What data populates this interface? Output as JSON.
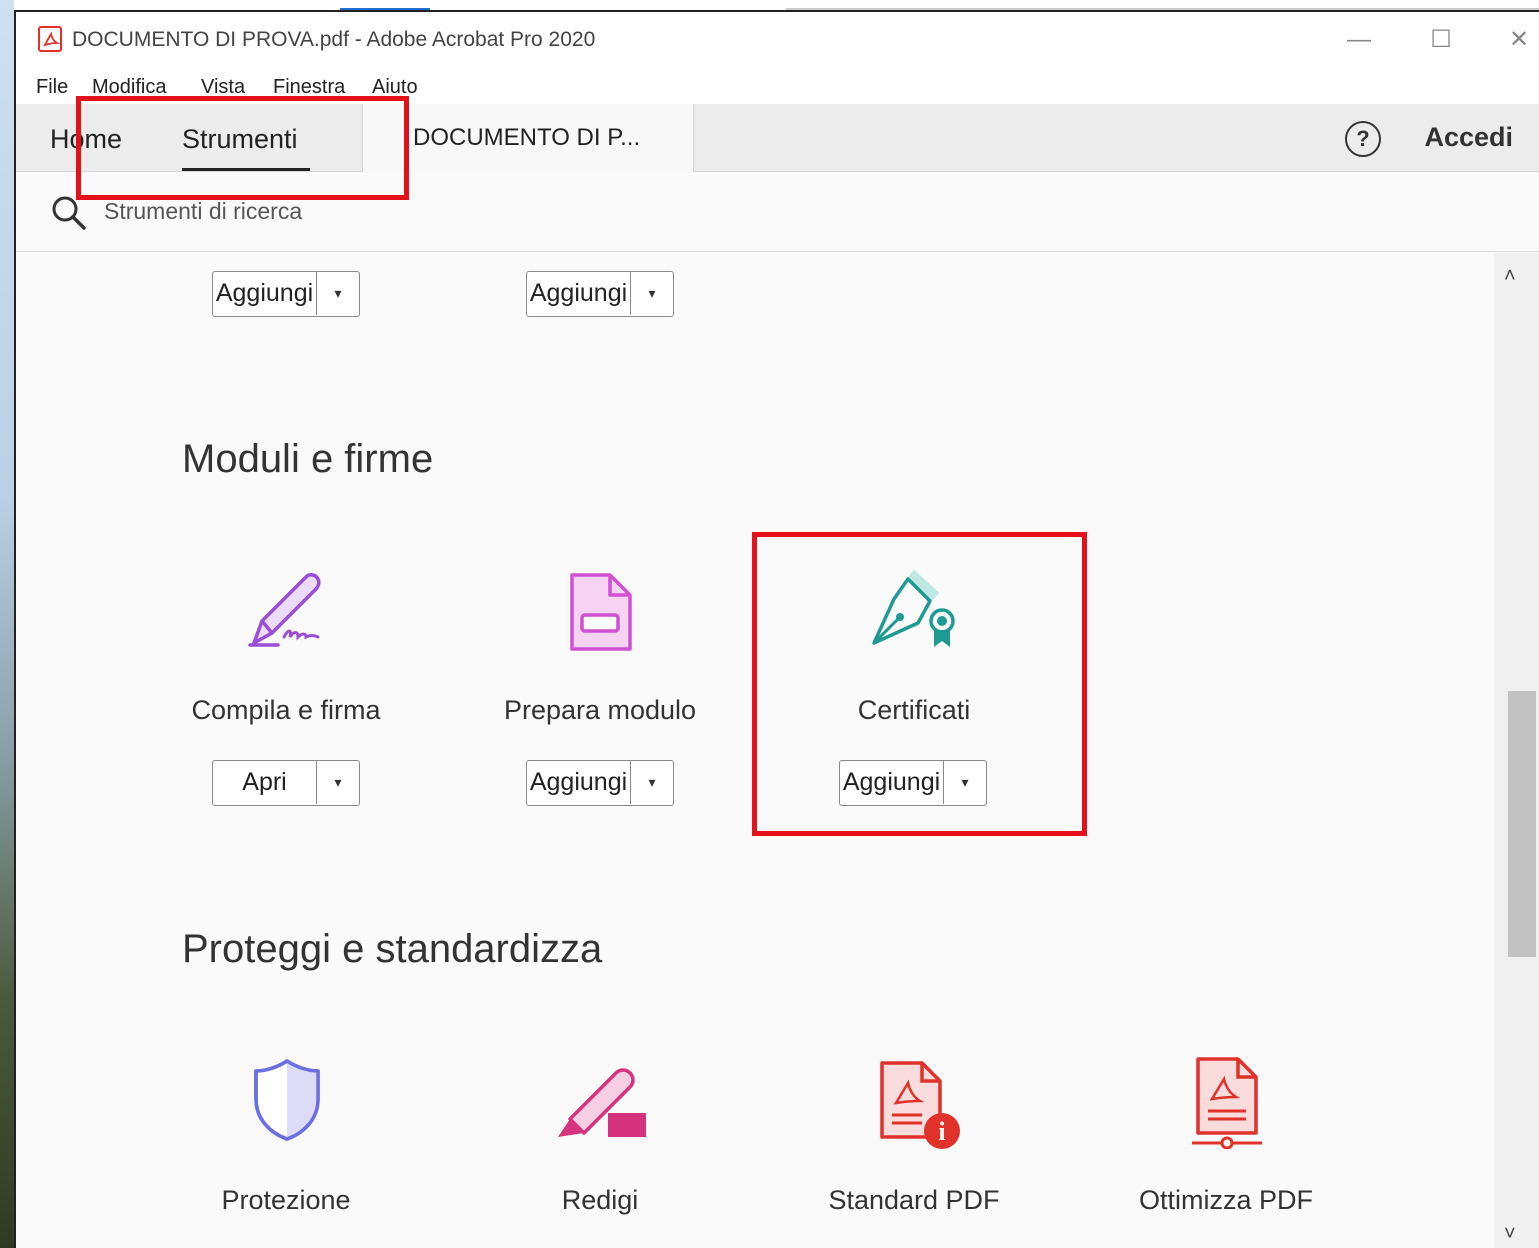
{
  "window": {
    "title": "DOCUMENTO DI PROVA.pdf - Adobe Acrobat Pro 2020",
    "min_glyph": "—",
    "max_glyph": "☐",
    "close_glyph": "✕"
  },
  "menubar": [
    "File",
    "Modifica",
    "Vista",
    "Finestra",
    "Aiuto"
  ],
  "tabs": {
    "home": "Home",
    "tools": "Strumenti",
    "document": "DOCUMENTO DI P...",
    "help_glyph": "?",
    "signin": "Accedi"
  },
  "search": {
    "placeholder": "Strumenti di ricerca"
  },
  "top_buttons": [
    {
      "label": "Aggiungi",
      "caret": "▾"
    },
    {
      "label": "Aggiungi",
      "caret": "▾"
    }
  ],
  "sections": [
    {
      "title": "Moduli e firme",
      "tools": [
        {
          "name": "Compila e firma",
          "icon": "fill-sign-icon",
          "button": "Apri",
          "caret": "▾"
        },
        {
          "name": "Prepara modulo",
          "icon": "prepare-form-icon",
          "button": "Aggiungi",
          "caret": "▾"
        },
        {
          "name": "Certificati",
          "icon": "certificates-icon",
          "button": "Aggiungi",
          "caret": "▾"
        }
      ]
    },
    {
      "title": "Proteggi e standardizza",
      "tools": [
        {
          "name": "Protezione",
          "icon": "protect-icon"
        },
        {
          "name": "Redigi",
          "icon": "redact-icon"
        },
        {
          "name": "Standard PDF",
          "icon": "pdf-standards-icon"
        },
        {
          "name": "Ottimizza PDF",
          "icon": "optimize-pdf-icon"
        }
      ]
    }
  ],
  "scrollbar": {
    "up_glyph": "˄",
    "down_glyph": "˅"
  },
  "colors": {
    "highlight": "#e4111b",
    "fill_sign": "#9b4fd9",
    "prepare_form": "#d14fd1",
    "certificates": "#1f9a93",
    "protect": "#6b6fe0",
    "redact": "#d6337f",
    "pdf_red": "#e0322a"
  }
}
